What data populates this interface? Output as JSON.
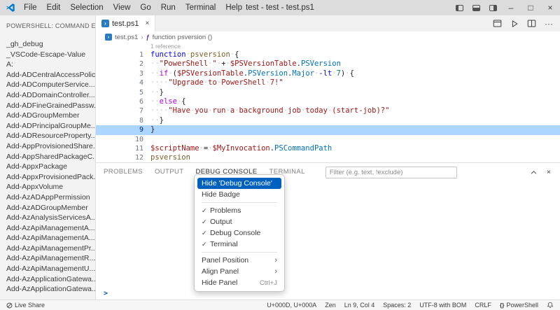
{
  "titlebar": {
    "menus": [
      "File",
      "Edit",
      "Selection",
      "View",
      "Go",
      "Run",
      "Terminal",
      "Help"
    ],
    "title": "test - test - test.ps1"
  },
  "sidebar": {
    "header": "POWERSHELL: COMMAND E...",
    "items": [
      "_gh_debug",
      "_VSCode-Escape-Value",
      "A:",
      "Add-ADCentralAccessPolic...",
      "Add-ADComputerService...",
      "Add-ADDomainController...",
      "Add-ADFineGrainedPassw...",
      "Add-ADGroupMember",
      "Add-ADPrincipalGroupMe...",
      "Add-ADResourceProperty...",
      "Add-AppProvisionedShare...",
      "Add-AppSharedPackageC...",
      "Add-AppxPackage",
      "Add-AppxProvisionedPack...",
      "Add-AppxVolume",
      "Add-AzADAppPermission",
      "Add-AzADGroupMember",
      "Add-AzAnalysisServicesA...",
      "Add-AzApiManagementA...",
      "Add-AzApiManagementA...",
      "Add-AzApiManagementPr...",
      "Add-AzApiManagementR...",
      "Add-AzApiManagementU...",
      "Add-AzApplicationGatewa...",
      "Add-AzApplicationGatewa..."
    ]
  },
  "editor": {
    "tab_label": "test.ps1",
    "breadcrumb": {
      "file": "test.ps1",
      "symbol": "function psversion ()"
    },
    "codelens": "1 reference",
    "current_line": 9,
    "lines": [
      {
        "n": 1,
        "t": [
          [
            "kw",
            "function"
          ],
          [
            "ws",
            "·"
          ],
          [
            "fn",
            "psversion"
          ],
          [
            "ws",
            "·"
          ],
          [
            "pun",
            "{"
          ]
        ]
      },
      {
        "n": 2,
        "t": [
          [
            "ws",
            "··"
          ],
          [
            "str",
            "\"PowerShell"
          ],
          [
            "ws",
            "·"
          ],
          [
            "str",
            "\""
          ],
          [
            "ws",
            "·"
          ],
          [
            "pun",
            "+"
          ],
          [
            "ws",
            "·"
          ],
          [
            "var",
            "$PSVersionTable"
          ],
          [
            "pun",
            "."
          ],
          [
            "prop",
            "PSVersion"
          ]
        ]
      },
      {
        "n": 3,
        "t": [
          [
            "ws",
            "··"
          ],
          [
            "ctrl",
            "if"
          ],
          [
            "ws",
            "·"
          ],
          [
            "pun",
            "("
          ],
          [
            "var",
            "$PSVersionTable"
          ],
          [
            "pun",
            "."
          ],
          [
            "prop",
            "PSVersion"
          ],
          [
            "pun",
            "."
          ],
          [
            "prop",
            "Major"
          ],
          [
            "ws",
            "·"
          ],
          [
            "op",
            "-lt"
          ],
          [
            "ws",
            "·"
          ],
          [
            "num",
            "7"
          ],
          [
            "pun",
            ")"
          ],
          [
            "ws",
            "·"
          ],
          [
            "pun",
            "{"
          ]
        ]
      },
      {
        "n": 4,
        "t": [
          [
            "ws",
            "····"
          ],
          [
            "str",
            "\"Upgrade"
          ],
          [
            "ws",
            "·"
          ],
          [
            "str",
            "to"
          ],
          [
            "ws",
            "·"
          ],
          [
            "str",
            "PowerShell"
          ],
          [
            "ws",
            "·"
          ],
          [
            "str",
            "7!\""
          ]
        ]
      },
      {
        "n": 5,
        "t": [
          [
            "ws",
            "··"
          ],
          [
            "pun",
            "}"
          ]
        ]
      },
      {
        "n": 6,
        "t": [
          [
            "ws",
            "··"
          ],
          [
            "ctrl",
            "else"
          ],
          [
            "ws",
            "·"
          ],
          [
            "pun",
            "{"
          ]
        ]
      },
      {
        "n": 7,
        "t": [
          [
            "ws",
            "····"
          ],
          [
            "str",
            "\"Have"
          ],
          [
            "ws",
            "·"
          ],
          [
            "str",
            "you"
          ],
          [
            "ws",
            "·"
          ],
          [
            "str",
            "run"
          ],
          [
            "ws",
            "·"
          ],
          [
            "str",
            "a"
          ],
          [
            "ws",
            "·"
          ],
          [
            "str",
            "background"
          ],
          [
            "ws",
            "·"
          ],
          [
            "str",
            "job"
          ],
          [
            "ws",
            "·"
          ],
          [
            "str",
            "today"
          ],
          [
            "ws",
            "·"
          ],
          [
            "str",
            "(start-job)?\""
          ]
        ]
      },
      {
        "n": 8,
        "t": [
          [
            "ws",
            "··"
          ],
          [
            "pun",
            "}"
          ]
        ]
      },
      {
        "n": 9,
        "t": [
          [
            "pun",
            "}"
          ]
        ]
      },
      {
        "n": 10,
        "t": []
      },
      {
        "n": 11,
        "t": [
          [
            "var",
            "$scriptName"
          ],
          [
            "ws",
            "·"
          ],
          [
            "pun",
            "="
          ],
          [
            "ws",
            "·"
          ],
          [
            "var",
            "$MyInvocation"
          ],
          [
            "pun",
            "."
          ],
          [
            "prop",
            "PSCommandPath"
          ]
        ]
      },
      {
        "n": 12,
        "t": [
          [
            "fn",
            "psversion"
          ]
        ]
      }
    ]
  },
  "panel": {
    "tabs": [
      "PROBLEMS",
      "OUTPUT",
      "DEBUG CONSOLE",
      "TERMINAL"
    ],
    "active_tab": "DEBUG CONSOLE",
    "filter_placeholder": "Filter (e.g. text, !exclude)",
    "prompt": ">"
  },
  "context_menu": {
    "items": [
      {
        "label": "Hide 'Debug Console'",
        "active": true
      },
      {
        "label": "Hide Badge"
      },
      {
        "sep": true
      },
      {
        "label": "Problems",
        "checked": true
      },
      {
        "label": "Output",
        "checked": true
      },
      {
        "label": "Debug Console",
        "checked": true
      },
      {
        "label": "Terminal",
        "checked": true
      },
      {
        "sep": true
      },
      {
        "label": "Panel Position",
        "submenu": true
      },
      {
        "label": "Align Panel",
        "submenu": true
      },
      {
        "label": "Hide Panel",
        "shortcut": "Ctrl+J"
      }
    ]
  },
  "statusbar": {
    "left": [
      {
        "icon": "live-share",
        "label": "Live Share"
      }
    ],
    "right": [
      {
        "label": "U+000D, U+000A"
      },
      {
        "label": "Zen"
      },
      {
        "label": "Ln 9, Col 4"
      },
      {
        "label": "Spaces: 2"
      },
      {
        "label": "UTF-8 with BOM"
      },
      {
        "label": "CRLF"
      },
      {
        "icon": "braces",
        "label": "PowerShell"
      },
      {
        "icon": "bell",
        "label": ""
      }
    ]
  },
  "icons": {
    "close": "×",
    "check": "✓",
    "chevron_right": "›",
    "more": "···",
    "minimize": "–",
    "maximize": "□",
    "braces": "{}",
    "function_symbol": "ƒ"
  },
  "colors": {
    "kw": "#0000ff",
    "ctrl": "#af00db",
    "fn": "#795e26",
    "str": "#a31515",
    "var": "#a31515",
    "prop": "#0070c1",
    "op": "#0000ff",
    "num": "#098658",
    "pun": "#1e1e1e",
    "ws": "#c5c5c5",
    "line_highlight": "#add6ff",
    "menu_selection": "#0060c0"
  }
}
